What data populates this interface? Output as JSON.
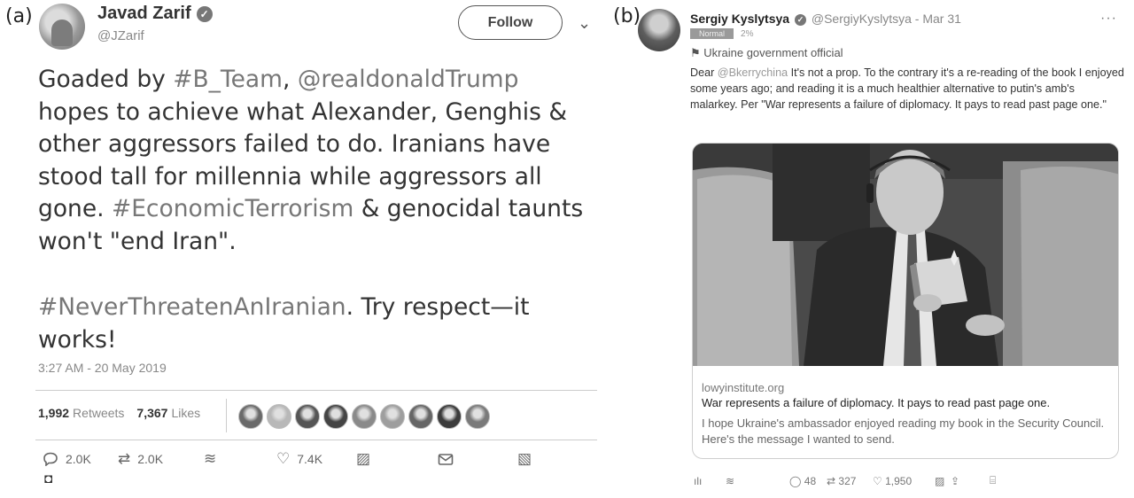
{
  "panel_a": {
    "label": "(a)",
    "user": {
      "name": "Javad Zarif",
      "handle": "@JZarif"
    },
    "follow_label": "Follow",
    "tweet": {
      "p1": [
        {
          "t": "Goaded by ",
          "tag": false
        },
        {
          "t": "#B_Team",
          "tag": true
        },
        {
          "t": ", ",
          "tag": false
        },
        {
          "t": "@realdonaldTrump",
          "tag": true
        },
        {
          "t": " hopes to achieve what Alexander, Genghis & other aggressors failed to do. Iranians have stood tall for millennia while aggressors all gone. ",
          "tag": false
        },
        {
          "t": "#EconomicTerrorism",
          "tag": true
        },
        {
          "t": " & genocidal taunts won't \"end Iran\".",
          "tag": false
        }
      ],
      "p2": [
        {
          "t": "#NeverThreatenAnIranian",
          "tag": true
        },
        {
          "t": ". Try respect—it works!",
          "tag": false
        }
      ]
    },
    "timestamp": "3:27 AM - 20 May 2019",
    "retweets_count": "1,992",
    "retweets_label": "Retweets",
    "likes_count": "7,367",
    "likes_label": "Likes",
    "avatar_shades": [
      "#6a6a6a",
      "#b8b8b8",
      "#555555",
      "#444444",
      "#8a8a8a",
      "#9e9e9e",
      "#666666",
      "#3c3c3c",
      "#7a7a7a"
    ],
    "actions": {
      "replies": "2.0K",
      "retweets": "2.0K",
      "likes": "7.4K"
    }
  },
  "panel_b": {
    "label": "(b)",
    "user": {
      "name": "Sergiy Kyslytsya",
      "handle": "@SergiyKyslytsya",
      "date": "Mar 31"
    },
    "badge": "Normal",
    "badge_pct": "2%",
    "official_label": "Ukraine government official",
    "tweet": {
      "dear": "Dear ",
      "mention": "@Bkerrychina",
      "body": " It's not a prop. To the contrary it's a re-reading of the book I enjoyed some years ago; and reading it is a much healthier alternative to putin's amb's malarkey. Per \"War represents a failure of diplomacy. It pays to read past page one.\""
    },
    "card": {
      "domain": "lowyinstitute.org",
      "title": "War represents a failure of diplomacy. It pays to read past page one.",
      "description": "I hope Ukraine's ambassador enjoyed reading my book in the Security Council. Here's the message I wanted to send."
    },
    "actions": {
      "replies": "48",
      "retweets": "327",
      "likes": "1,950"
    }
  }
}
